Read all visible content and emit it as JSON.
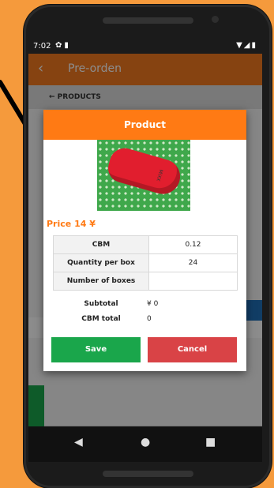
{
  "status_bar": {
    "time": "7:02"
  },
  "app_bar": {
    "back_icon": "chevron-left-icon",
    "title": "Pre-orden"
  },
  "sub_bar": {
    "label": "← PRODUCTS"
  },
  "dialog": {
    "title": "Product",
    "price": "Price 14 ¥",
    "specs": [
      {
        "key": "CBM",
        "value": "0.12"
      },
      {
        "key": "Quantity per box",
        "value": "24"
      },
      {
        "key": "Number of boxes",
        "value": ""
      }
    ],
    "totals": [
      {
        "key": "Subtotal",
        "value": "¥ 0"
      },
      {
        "key": "CBM total",
        "value": "0"
      }
    ],
    "buttons": {
      "save": "Save",
      "cancel": "Cancel"
    },
    "colors": {
      "header": "#ff7a14",
      "save": "#1aa64b",
      "cancel": "#d94346"
    }
  },
  "nav_bar": {
    "back": "◀",
    "home": "●",
    "recents": "■"
  },
  "annotation": {
    "type": "arrow",
    "color": "#000000"
  }
}
